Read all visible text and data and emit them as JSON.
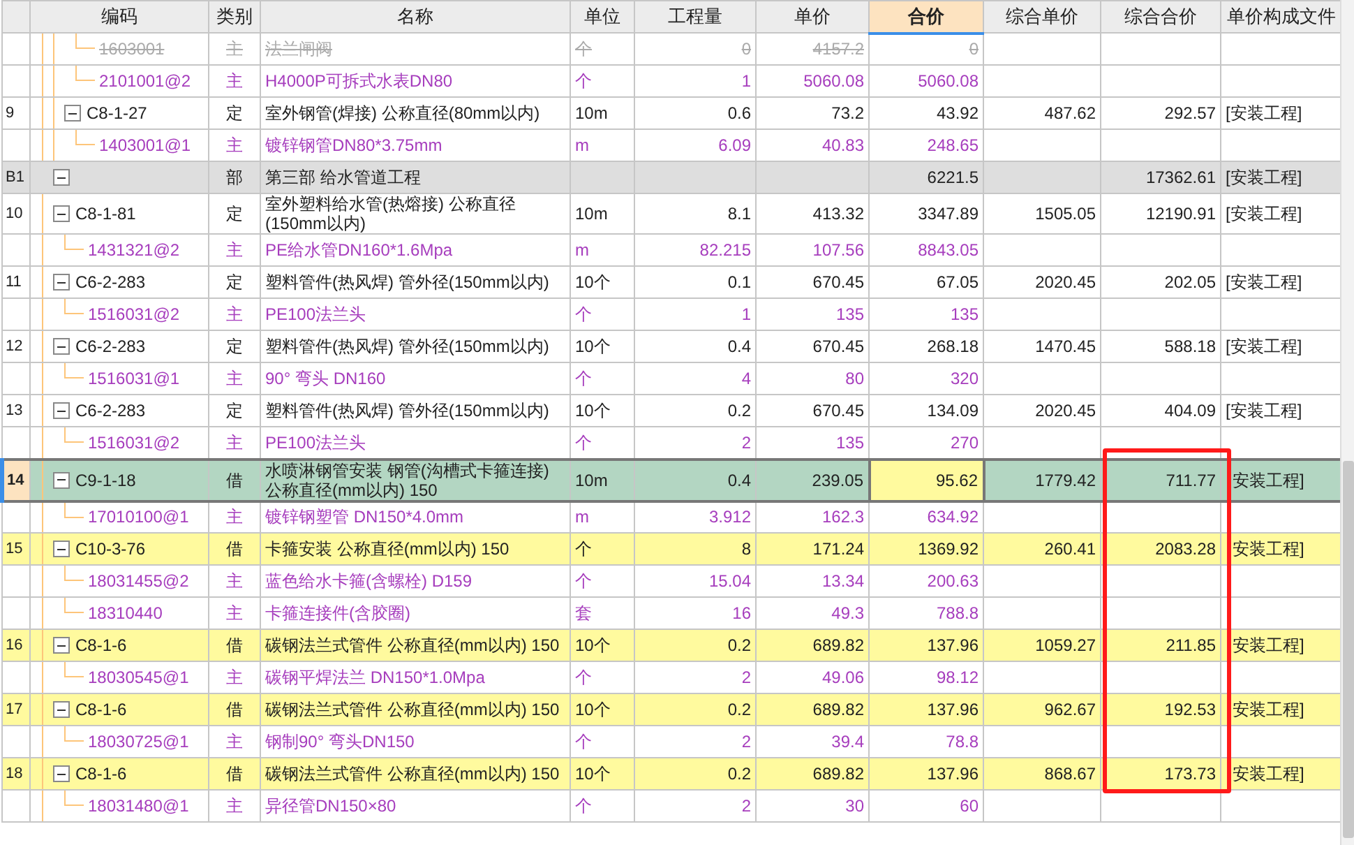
{
  "columns": [
    {
      "label": "编码",
      "selected": false
    },
    {
      "label": "类别",
      "selected": false
    },
    {
      "label": "名称",
      "selected": false
    },
    {
      "label": "单位",
      "selected": false
    },
    {
      "label": "工程量",
      "selected": false
    },
    {
      "label": "单价",
      "selected": false
    },
    {
      "label": "合价",
      "selected": true
    },
    {
      "label": "综合单价",
      "selected": false
    },
    {
      "label": "综合合价",
      "selected": false
    },
    {
      "label": "单价构成文件",
      "selected": false
    }
  ],
  "rows": [
    {
      "kind": "material",
      "struck": true,
      "selected": false,
      "marked": false,
      "boxed": false,
      "code": "1603001",
      "type": "主",
      "name": "法兰闸阀",
      "unit": "个",
      "qty": "0",
      "price": "4157.2",
      "total": "0"
    },
    {
      "kind": "material",
      "struck": false,
      "selected": false,
      "marked": false,
      "boxed": false,
      "code": "2101001@2",
      "type": "主",
      "name": "H4000P可拆式水表DN80",
      "unit": "个",
      "qty": "1",
      "price": "5060.08",
      "total": "5060.08"
    },
    {
      "kind": "item",
      "struck": false,
      "selected": false,
      "marked": false,
      "boxed": false,
      "no": "9",
      "code": "C8-1-27",
      "type": "定",
      "name": "室外钢管(焊接) 公称直径(80mm以内)",
      "unit": "10m",
      "qty": "0.6",
      "price": "73.2",
      "total": "43.92",
      "comp_price": "487.62",
      "comp_total": "292.57",
      "file": "[安装工程]"
    },
    {
      "kind": "material",
      "struck": false,
      "selected": false,
      "marked": false,
      "boxed": false,
      "code": "1403001@1",
      "type": "主",
      "name": "镀锌钢管DN80*3.75mm",
      "unit": "m",
      "qty": "6.09",
      "price": "40.83",
      "total": "248.65"
    },
    {
      "kind": "section",
      "struck": false,
      "selected": false,
      "marked": false,
      "boxed": false,
      "no": "B1",
      "type": "部",
      "name": "第三部 给水管道工程",
      "total": "6221.5",
      "comp_total": "17362.61",
      "file": "[安装工程]"
    },
    {
      "kind": "item",
      "struck": false,
      "selected": false,
      "marked": false,
      "boxed": false,
      "no": "10",
      "code": "C8-1-81",
      "type": "定",
      "name": "室外塑料给水管(热熔接) 公称直径(150mm以内)",
      "unit": "10m",
      "qty": "8.1",
      "price": "413.32",
      "total": "3347.89",
      "comp_price": "1505.05",
      "comp_total": "12190.91",
      "file": "[安装工程]"
    },
    {
      "kind": "material",
      "struck": false,
      "selected": false,
      "marked": false,
      "boxed": false,
      "code": "1431321@2",
      "type": "主",
      "name": "PE给水管DN160*1.6Mpa",
      "unit": "m",
      "qty": "82.215",
      "price": "107.56",
      "total": "8843.05"
    },
    {
      "kind": "item",
      "struck": false,
      "selected": false,
      "marked": false,
      "boxed": false,
      "no": "11",
      "code": "C6-2-283",
      "type": "定",
      "name": "塑料管件(热风焊) 管外径(150mm以内)",
      "unit": "10个",
      "qty": "0.1",
      "price": "670.45",
      "total": "67.05",
      "comp_price": "2020.45",
      "comp_total": "202.05",
      "file": "[安装工程]"
    },
    {
      "kind": "material",
      "struck": false,
      "selected": false,
      "marked": false,
      "boxed": false,
      "code": "1516031@2",
      "type": "主",
      "name": "PE100法兰头",
      "unit": "个",
      "qty": "1",
      "price": "135",
      "total": "135"
    },
    {
      "kind": "item",
      "struck": false,
      "selected": false,
      "marked": false,
      "boxed": false,
      "no": "12",
      "code": "C6-2-283",
      "type": "定",
      "name": "塑料管件(热风焊) 管外径(150mm以内)",
      "unit": "10个",
      "qty": "0.4",
      "price": "670.45",
      "total": "268.18",
      "comp_price": "1470.45",
      "comp_total": "588.18",
      "file": "[安装工程]"
    },
    {
      "kind": "material",
      "struck": false,
      "selected": false,
      "marked": false,
      "boxed": false,
      "code": "1516031@1",
      "type": "主",
      "name": "90° 弯头 DN160",
      "unit": "个",
      "qty": "4",
      "price": "80",
      "total": "320"
    },
    {
      "kind": "item",
      "struck": false,
      "selected": false,
      "marked": false,
      "boxed": false,
      "no": "13",
      "code": "C6-2-283",
      "type": "定",
      "name": "塑料管件(热风焊) 管外径(150mm以内)",
      "unit": "10个",
      "qty": "0.2",
      "price": "670.45",
      "total": "134.09",
      "comp_price": "2020.45",
      "comp_total": "404.09",
      "file": "[安装工程]"
    },
    {
      "kind": "material",
      "struck": false,
      "selected": false,
      "marked": false,
      "boxed": false,
      "code": "1516031@2",
      "type": "主",
      "name": "PE100法兰头",
      "unit": "个",
      "qty": "2",
      "price": "135",
      "total": "270"
    },
    {
      "kind": "item",
      "struck": false,
      "selected": true,
      "marked": false,
      "boxed": true,
      "no": "14",
      "code": "C9-1-18",
      "type": "借",
      "name": "水喷淋钢管安装 钢管(沟槽式卡箍连接) 公称直径(mm以内) 150",
      "unit": "10m",
      "qty": "0.4",
      "price": "239.05",
      "total": "95.62",
      "comp_price": "1779.42",
      "comp_total": "711.77",
      "file": "安装工程]"
    },
    {
      "kind": "material",
      "struck": false,
      "selected": false,
      "marked": false,
      "boxed": true,
      "code": "17010100@1",
      "type": "主",
      "name": "镀锌钢塑管  DN150*4.0mm",
      "unit": "m",
      "qty": "3.912",
      "price": "162.3",
      "total": "634.92"
    },
    {
      "kind": "item",
      "struck": false,
      "selected": false,
      "marked": true,
      "boxed": true,
      "no": "15",
      "code": "C10-3-76",
      "type": "借",
      "name": "卡箍安装 公称直径(mm以内) 150",
      "unit": "个",
      "qty": "8",
      "price": "171.24",
      "total": "1369.92",
      "comp_price": "260.41",
      "comp_total": "2083.28",
      "file": "安装工程]"
    },
    {
      "kind": "material",
      "struck": false,
      "selected": false,
      "marked": false,
      "boxed": true,
      "code": "18031455@2",
      "type": "主",
      "name": "蓝色给水卡箍(含螺栓) D159",
      "unit": "个",
      "qty": "15.04",
      "price": "13.34",
      "total": "200.63"
    },
    {
      "kind": "material",
      "struck": false,
      "selected": false,
      "marked": false,
      "boxed": true,
      "code": "18310440",
      "type": "主",
      "name": "卡箍连接件(含胶圈)",
      "unit": "套",
      "qty": "16",
      "price": "49.3",
      "total": "788.8"
    },
    {
      "kind": "item",
      "struck": false,
      "selected": false,
      "marked": true,
      "boxed": true,
      "no": "16",
      "code": "C8-1-6",
      "type": "借",
      "name": "碳钢法兰式管件 公称直径(mm以内) 150",
      "unit": "10个",
      "qty": "0.2",
      "price": "689.82",
      "total": "137.96",
      "comp_price": "1059.27",
      "comp_total": "211.85",
      "file": "安装工程]"
    },
    {
      "kind": "material",
      "struck": false,
      "selected": false,
      "marked": false,
      "boxed": true,
      "code": "18030545@1",
      "type": "主",
      "name": "碳钢平焊法兰 DN150*1.0Mpa",
      "unit": "个",
      "qty": "2",
      "price": "49.06",
      "total": "98.12"
    },
    {
      "kind": "item",
      "struck": false,
      "selected": false,
      "marked": true,
      "boxed": true,
      "no": "17",
      "code": "C8-1-6",
      "type": "借",
      "name": "碳钢法兰式管件 公称直径(mm以内) 150",
      "unit": "10个",
      "qty": "0.2",
      "price": "689.82",
      "total": "137.96",
      "comp_price": "962.67",
      "comp_total": "192.53",
      "file": "安装工程]"
    },
    {
      "kind": "material",
      "struck": false,
      "selected": false,
      "marked": false,
      "boxed": true,
      "code": "18030725@1",
      "type": "主",
      "name": "钢制90° 弯头DN150",
      "unit": "个",
      "qty": "2",
      "price": "39.4",
      "total": "78.8"
    },
    {
      "kind": "item",
      "struck": false,
      "selected": false,
      "marked": true,
      "boxed": true,
      "no": "18",
      "code": "C8-1-6",
      "type": "借",
      "name": "碳钢法兰式管件 公称直径(mm以内) 150",
      "unit": "10个",
      "qty": "0.2",
      "price": "689.82",
      "total": "137.96",
      "comp_price": "868.67",
      "comp_total": "173.73",
      "file": "安装工程]"
    },
    {
      "kind": "material",
      "struck": false,
      "selected": false,
      "marked": false,
      "boxed": false,
      "code": "18031480@1",
      "type": "主",
      "name": "异径管DN150×80",
      "unit": "个",
      "qty": "2",
      "price": "30",
      "total": "60"
    }
  ]
}
